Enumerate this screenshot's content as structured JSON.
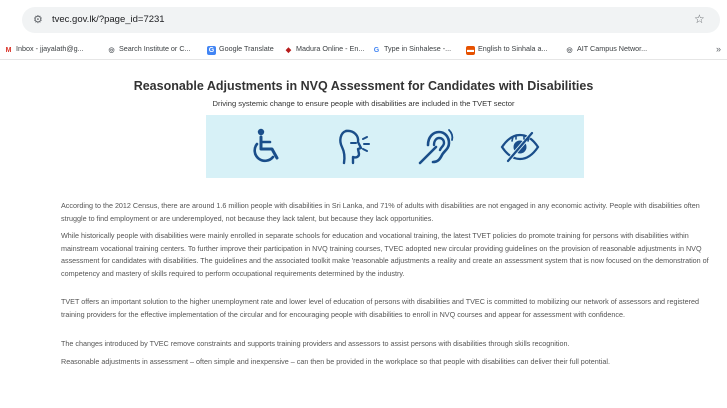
{
  "browser": {
    "url": "tvec.gov.lk/?page_id=7231",
    "bookmarks": [
      {
        "icon": "gmail-icon",
        "label": "Inbox - jjayalath@g...",
        "color": "#d93025",
        "glyph": "M"
      },
      {
        "icon": "globe-icon",
        "label": "Search Institute or C...",
        "color": "#5f6368",
        "glyph": "◎"
      },
      {
        "icon": "google-translate-icon",
        "label": "Google Translate",
        "color": "#4285f4",
        "glyph": "G"
      },
      {
        "icon": "madura-icon",
        "label": "Madura Online - En...",
        "color": "#b71c1c",
        "glyph": "◆"
      },
      {
        "icon": "google-icon",
        "label": "Type in Sinhalese -...",
        "color": "#4285f4",
        "glyph": "G"
      },
      {
        "icon": "bookmark-icon",
        "label": "English to Sinhala a...",
        "color": "#e65100",
        "glyph": "▬"
      },
      {
        "icon": "globe-icon",
        "label": "AIT Campus Networ...",
        "color": "#5f6368",
        "glyph": "◎"
      }
    ],
    "more": "»"
  },
  "page": {
    "title": "Reasonable Adjustments in NVQ Assessment for Candidates with Disabilities",
    "subtitle": "Driving systemic change to ensure people with disabilities are included in the TVET sector",
    "banner_color": "#d7f1f7",
    "banner_icons": [
      "wheelchair-icon",
      "speech-impairment-icon",
      "hearing-impairment-icon",
      "visual-impairment-icon"
    ],
    "paragraphs": [
      "According to the 2012 Census, there are around 1.6 million people with disabilities in Sri Lanka, and 71% of adults with disabilities are not engaged in any economic activity. People with disabilities often struggle to find employment or are underemployed, not because they lack talent, but because they lack opportunities.",
      "While historically people with disabilities were mainly enrolled in separate schools for education and vocational training, the latest TVET policies do promote training for persons with disabilities within mainstream vocational training centers. To further improve their participation in NVQ training courses, TVEC adopted new circular providing guidelines on the provision of reasonable adjustments in NVQ assessment for candidates with disabilities. The guidelines and the associated toolkit make 'reasonable adjustments a reality and create an assessment system that is now focused on the demonstration of competency and mastery of skills required to perform occupational requirements determined by the industry.",
      "TVET offers an important solution to the higher unemployment rate and lower level of education of persons with disabilities and TVEC is committed to mobilizing our network of assessors and registered training providers for the effective implementation of the circular and for encouraging people with disabilities to enroll in NVQ courses and appear for assessment with confidence.",
      "The changes introduced by TVEC remove constraints and supports training providers and assessors to assist persons with disabilities through skills recognition.",
      "Reasonable adjustments in assessment – often simple and inexpensive – can then be provided in the workplace so that people with disabilities can deliver their full potential."
    ]
  }
}
